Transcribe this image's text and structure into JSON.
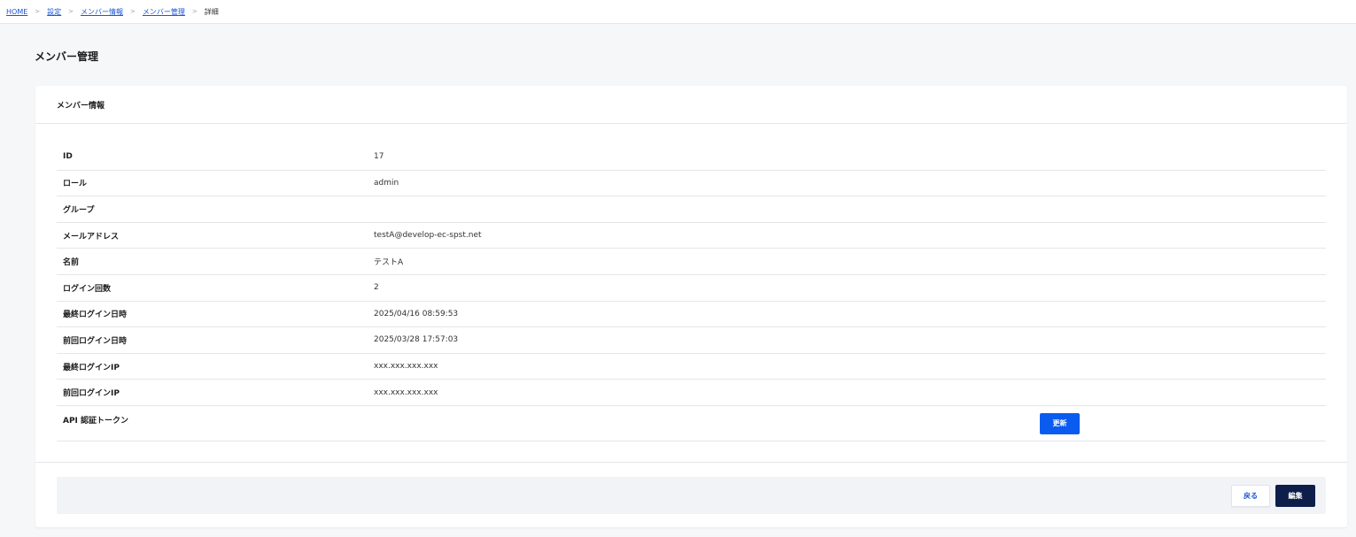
{
  "breadcrumb": {
    "items": [
      {
        "label": "HOME"
      },
      {
        "label": "設定"
      },
      {
        "label": "メンバー情報"
      },
      {
        "label": "メンバー管理"
      }
    ],
    "current": "詳細",
    "separator": ">"
  },
  "page": {
    "title": "メンバー管理"
  },
  "card": {
    "title": "メンバー情報"
  },
  "details": [
    {
      "label": "ID",
      "value": "17"
    },
    {
      "label": "ロール",
      "value": "admin"
    },
    {
      "label": "グループ",
      "value": ""
    },
    {
      "label": "メールアドレス",
      "value": "testA@develop-ec-spst.net"
    },
    {
      "label": "名前",
      "value": "テストA"
    },
    {
      "label": "ログイン回数",
      "value": "2"
    },
    {
      "label": "最終ログイン日時",
      "value": "2025/04/16 08:59:53"
    },
    {
      "label": "前回ログイン日時",
      "value": "2025/03/28 17:57:03"
    },
    {
      "label": "最終ログインIP",
      "value": "xxx.xxx.xxx.xxx"
    },
    {
      "label": "前回ログインIP",
      "value": "xxx.xxx.xxx.xxx"
    }
  ],
  "token": {
    "label": "API 認証トークン",
    "update_label": "更新"
  },
  "footer": {
    "back_label": "戻る",
    "edit_label": "編集"
  },
  "colors": {
    "primary": "#0a5cf0",
    "navy": "#0d1e4a",
    "link": "#1a55d6"
  }
}
